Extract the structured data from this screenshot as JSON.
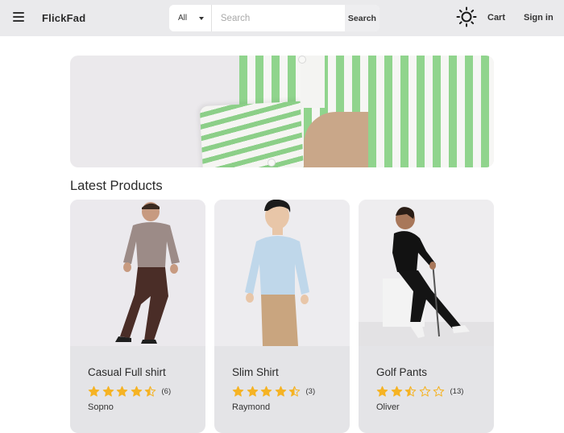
{
  "header": {
    "brand": "FlickFad",
    "category_select": "All",
    "search_placeholder": "Search",
    "search_button": "Search",
    "cart_label": "Cart",
    "signin_label": "Sign in"
  },
  "section_title": "Latest Products",
  "products": [
    {
      "title": "Casual Full shirt",
      "rating": 4.5,
      "reviews": "(6)",
      "brand": "Sopno"
    },
    {
      "title": "Slim Shirt",
      "rating": 4.5,
      "reviews": "(3)",
      "brand": "Raymond"
    },
    {
      "title": "Golf Pants",
      "rating": 2.5,
      "reviews": "(13)",
      "brand": "Oliver"
    }
  ],
  "colors": {
    "header_bg": "#eaeaec",
    "star": "#f5b324",
    "card_bg": "#e4e4e7",
    "stripe_green": "#90d48d"
  },
  "icons": {
    "menu": "hamburger-icon",
    "theme": "sun-icon",
    "dropdown": "chevron-down-icon",
    "star": "star-icon"
  }
}
